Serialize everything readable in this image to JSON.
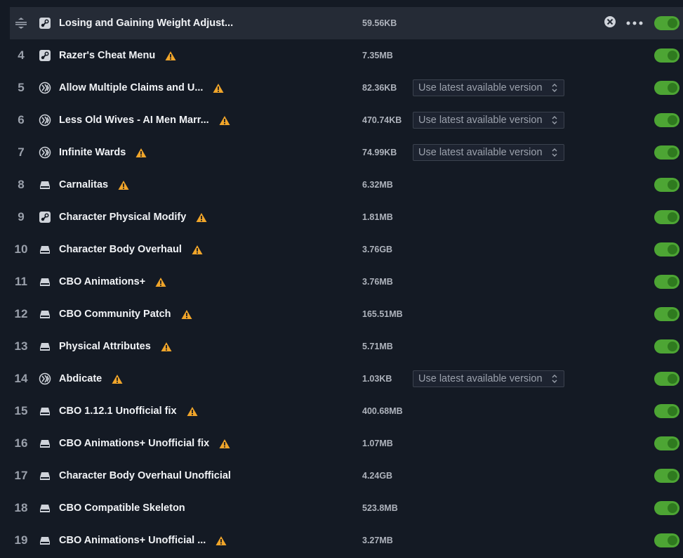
{
  "version_default": "Use latest available version",
  "rows": [
    {
      "index": "",
      "name": "Losing and Gaining Weight Adjust...",
      "size": "59.56KB",
      "source": "steam-icon",
      "warn": false,
      "version": false,
      "active": true
    },
    {
      "index": "4",
      "name": "Razer's Cheat Menu",
      "size": "7.35MB",
      "source": "steam-icon",
      "warn": true,
      "version": false
    },
    {
      "index": "5",
      "name": "Allow Multiple Claims and U...",
      "size": "82.36KB",
      "source": "paradox-icon",
      "warn": true,
      "version": true
    },
    {
      "index": "6",
      "name": "Less Old Wives - AI Men Marr...",
      "size": "470.74KB",
      "source": "paradox-icon",
      "warn": true,
      "version": true
    },
    {
      "index": "7",
      "name": "Infinite Wards",
      "size": "74.99KB",
      "source": "paradox-icon",
      "warn": true,
      "version": true
    },
    {
      "index": "8",
      "name": "Carnalitas",
      "size": "6.32MB",
      "source": "drive-icon",
      "warn": true,
      "version": false
    },
    {
      "index": "9",
      "name": "Character Physical Modify",
      "size": "1.81MB",
      "source": "steam-icon",
      "warn": true,
      "version": false
    },
    {
      "index": "10",
      "name": "Character Body Overhaul",
      "size": "3.76GB",
      "source": "drive-icon",
      "warn": true,
      "version": false
    },
    {
      "index": "11",
      "name": "CBO Animations+",
      "size": "3.76MB",
      "source": "drive-icon",
      "warn": true,
      "version": false
    },
    {
      "index": "12",
      "name": "CBO Community Patch",
      "size": "165.51MB",
      "source": "drive-icon",
      "warn": true,
      "version": false
    },
    {
      "index": "13",
      "name": "Physical Attributes",
      "size": "5.71MB",
      "source": "drive-icon",
      "warn": true,
      "version": false
    },
    {
      "index": "14",
      "name": "Abdicate",
      "size": "1.03KB",
      "source": "paradox-icon",
      "warn": true,
      "version": true
    },
    {
      "index": "15",
      "name": "CBO 1.12.1 Unofficial fix",
      "size": "400.68MB",
      "source": "drive-icon",
      "warn": true,
      "version": false
    },
    {
      "index": "16",
      "name": "CBO Animations+ Unofficial fix",
      "size": "1.07MB",
      "source": "drive-icon",
      "warn": true,
      "version": false
    },
    {
      "index": "17",
      "name": "Character Body Overhaul Unofficial",
      "size": "4.24GB",
      "source": "drive-icon",
      "warn": false,
      "version": false
    },
    {
      "index": "18",
      "name": "CBO Compatible Skeleton",
      "size": "523.8MB",
      "source": "drive-icon",
      "warn": false,
      "version": false
    },
    {
      "index": "19",
      "name": "CBO Animations+ Unofficial ...",
      "size": "3.27MB",
      "source": "drive-icon",
      "warn": true,
      "version": false
    }
  ],
  "colors": {
    "background": "#141a24",
    "row_active": "#252b36",
    "toggle_on": "#4da534",
    "warning": "#f0a52a"
  },
  "icons": {
    "drag": "drag-handle-icon",
    "remove": "close-circle-icon",
    "more": "more-dots-icon",
    "warning": "warning-icon",
    "chevron": "chevron-updown-icon"
  }
}
